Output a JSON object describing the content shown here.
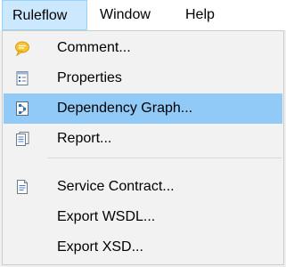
{
  "menubar": {
    "items": [
      {
        "label": "Ruleflow"
      },
      {
        "label": "Window"
      },
      {
        "label": "Help"
      }
    ]
  },
  "dropdown": {
    "items": [
      {
        "label": "Comment...",
        "icon": "comment-icon"
      },
      {
        "label": "Properties",
        "icon": "properties-icon"
      },
      {
        "label": "Dependency Graph...",
        "icon": "dependency-graph-icon",
        "highlighted": true
      },
      {
        "label": "Report...",
        "icon": "report-icon"
      },
      {
        "label": "Service Contract...",
        "icon": "service-contract-icon"
      },
      {
        "label": "Export WSDL..."
      },
      {
        "label": "Export XSD..."
      }
    ]
  },
  "colors": {
    "menubar_active_bg": "#cce8ff",
    "highlight_bg": "#91c9f7",
    "menu_bg": "#f2f2f2"
  }
}
